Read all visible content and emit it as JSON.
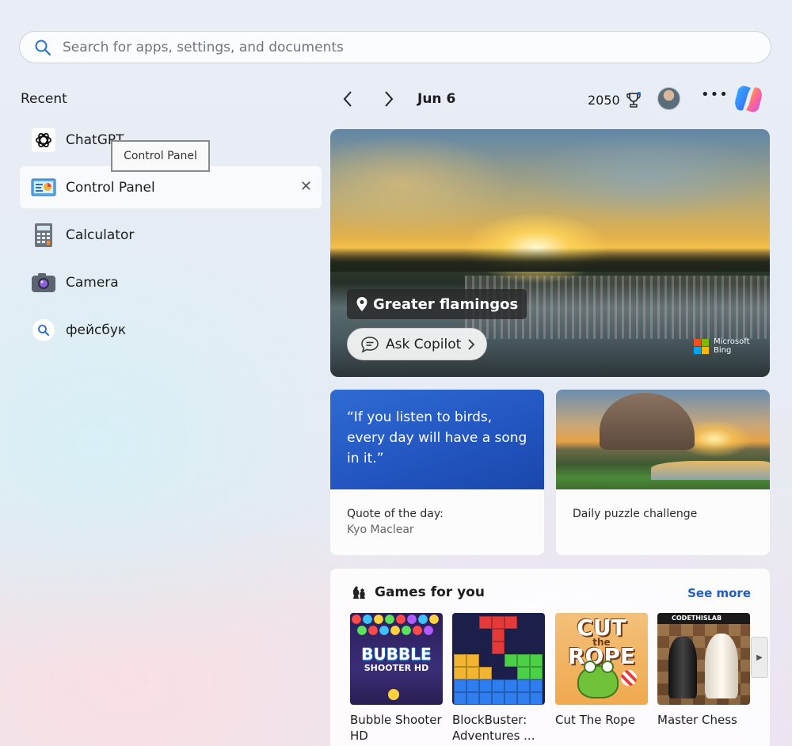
{
  "search": {
    "placeholder": "Search for apps, settings, and documents"
  },
  "recent": {
    "title": "Recent",
    "items": [
      {
        "label": "ChatGPT",
        "icon": "chatgpt-icon"
      },
      {
        "label": "Control Panel",
        "icon": "control-panel-icon"
      },
      {
        "label": "Calculator",
        "icon": "calculator-icon"
      },
      {
        "label": "Camera",
        "icon": "camera-icon"
      },
      {
        "label": "фейсбук",
        "icon": "search-icon"
      }
    ]
  },
  "tooltip": {
    "text": "Control Panel"
  },
  "topbar": {
    "date": "Jun 6",
    "points": "2050"
  },
  "hero": {
    "place": "Greater flamingos",
    "ask_copilot": "Ask Copilot",
    "bing_line1": "Microsoft",
    "bing_line2": "Bing"
  },
  "cards": {
    "quote": {
      "text": "“If you listen to birds, every day will have a song in it.”",
      "label": "Quote of the day:",
      "author": "Kyo Maclear"
    },
    "puzzle": {
      "label": "Daily puzzle challenge"
    }
  },
  "games": {
    "title": "Games for you",
    "see_more": "See more",
    "tiles": [
      {
        "name": "Bubble Shooter HD",
        "logo": "BUBBLE",
        "logo_sub": "SHOOTER HD"
      },
      {
        "name": "BlockBuster: Adventures ..."
      },
      {
        "name": "Cut The Rope",
        "logo_line1": "CUT",
        "logo_line2": "the",
        "logo_line3": "ROPE"
      },
      {
        "name": "Master Chess",
        "logo": "CODETHISLAB"
      }
    ]
  },
  "colors": {
    "link": "#1f5fbf",
    "accent_blue": "#2356c0"
  }
}
